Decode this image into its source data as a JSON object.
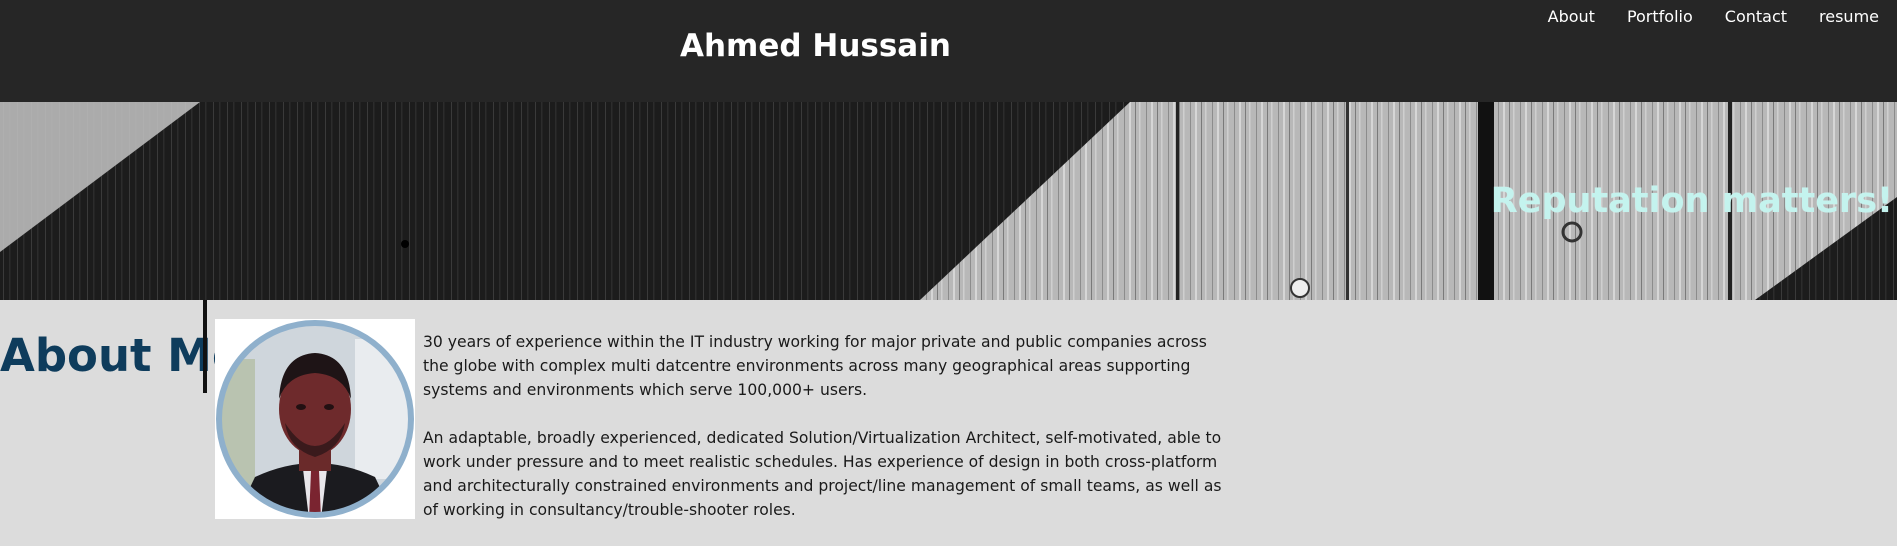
{
  "header": {
    "title": "Ahmed Hussain",
    "nav": [
      {
        "label": "About"
      },
      {
        "label": "Portfolio"
      },
      {
        "label": "Contact"
      },
      {
        "label": "resume"
      }
    ],
    "background_color": "#262626"
  },
  "banner": {
    "tagline": "Reputation matters!",
    "tagline_color": "#c4f3ee"
  },
  "about": {
    "heading": "About Me",
    "heading_color": "#0e3c5c",
    "paragraphs": [
      "30 years of experience within the IT industry working for major private and public companies across the globe with complex multi datcentre environments across many geographical areas supporting systems and environments which serve 100,000+ users.",
      "An adaptable, broadly experienced, dedicated Solution/Virtualization Architect, self-motivated, able to work under pressure and to meet realistic schedules. Has experience of design in both cross-platform and architecturally constrained environments and project/line management of small teams, as well as of working in consultancy/trouble-shooter roles."
    ]
  },
  "colors": {
    "page_background": "#dcdcdc",
    "photo_ring": "#8fb0cc"
  }
}
